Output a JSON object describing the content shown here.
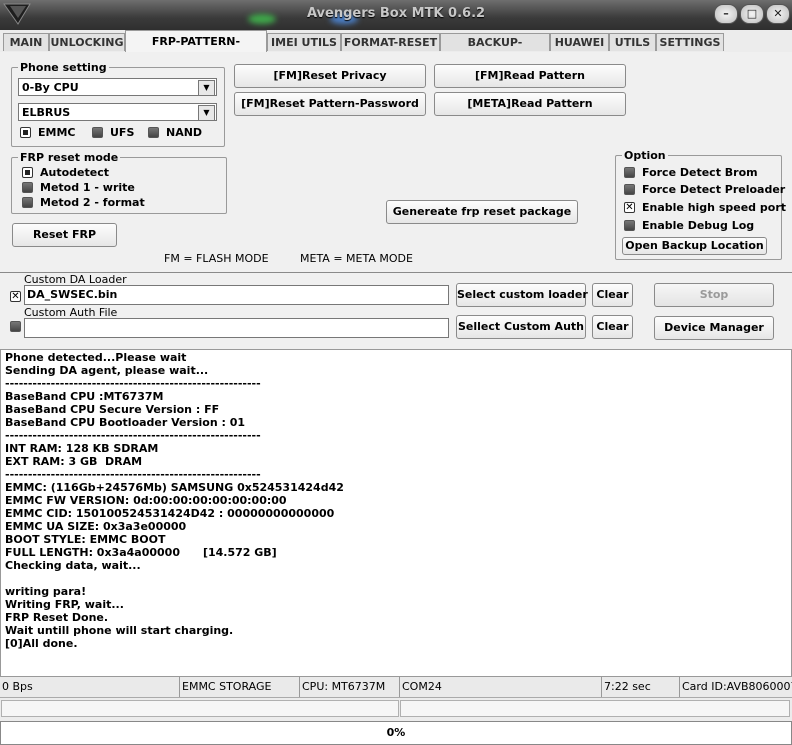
{
  "window": {
    "title": "Avengers Box MTK 0.6.2",
    "min_glyph": "–",
    "max_glyph": "□",
    "close_glyph": "✕"
  },
  "tabs": [
    {
      "label": "MAIN"
    },
    {
      "label": "UNLOCKING"
    },
    {
      "label": "FRP-PATTERN-PRIVACY",
      "active": true
    },
    {
      "label": "IMEI UTILS"
    },
    {
      "label": "FORMAT-RESET"
    },
    {
      "label": "BACKUP-RESTORE"
    },
    {
      "label": "HUAWEI"
    },
    {
      "label": "UTILS"
    },
    {
      "label": "SETTINGS"
    }
  ],
  "phone_setting": {
    "legend": "Phone setting",
    "cpu_select": "0-By CPU",
    "model_select": "ELBRUS",
    "storage": [
      {
        "label": "EMMC",
        "checked": true
      },
      {
        "label": "UFS",
        "checked": false
      },
      {
        "label": "NAND",
        "checked": false
      }
    ]
  },
  "actions": {
    "reset_privacy": "[FM]Reset Privacy",
    "read_pattern": "[FM]Read Pattern",
    "reset_pattern_password": "[FM]Reset Pattern-Password",
    "meta_read_pattern": "[META]Read Pattern"
  },
  "frp_mode": {
    "legend": "FRP reset mode",
    "options": [
      {
        "label": "Autodetect",
        "checked": true
      },
      {
        "label": "Metod 1 - write",
        "checked": false
      },
      {
        "label": "Metod 2 - format",
        "checked": false
      }
    ]
  },
  "reset_frp_button": "Reset FRP",
  "generate_button": "Genereate frp reset package",
  "legend_notes": {
    "fm": "FM = FLASH MODE",
    "meta": "META = META MODE"
  },
  "option": {
    "legend": "Option",
    "items": [
      {
        "label": "Force Detect Brom",
        "checked": false
      },
      {
        "label": "Force Detect Preloader",
        "checked": false
      },
      {
        "label": "Enable high speed port",
        "checked": true
      },
      {
        "label": "Enable Debug Log",
        "checked": false
      }
    ],
    "open_backup": "Open Backup Location"
  },
  "da": {
    "loader_label": "Custom DA Loader",
    "loader_value": "DA_SWSEC.bin",
    "loader_checked": true,
    "select_loader": "Select custom loader",
    "clear1": "Clear",
    "auth_label": "Custom Auth File",
    "auth_value": "",
    "auth_checked": false,
    "select_auth": "Sellect Custom Auth",
    "clear2": "Clear",
    "stop": "Stop",
    "device_manager": "Device Manager"
  },
  "log": [
    "Phone detected...Please wait",
    "Sending DA agent, please wait...",
    "--------------------------------------------------------",
    "BaseBand CPU :MT6737M",
    "BaseBand CPU Secure Version : FF",
    "BaseBand CPU Bootloader Version : 01",
    "--------------------------------------------------------",
    "INT RAM: 128 KB SDRAM",
    "EXT RAM: 3 GB  DRAM",
    "--------------------------------------------------------",
    "EMMC: (116Gb+24576Mb) SAMSUNG 0x524531424d42",
    "EMMC FW VERSION: 0d:00:00:00:00:00:00:00",
    "EMMC CID: 150100524531424D42 : 00000000000000",
    "EMMC UA SIZE: 0x3a3e00000",
    "BOOT STYLE: EMMC BOOT",
    "FULL LENGTH: 0x3a4a00000      [14.572 GB]",
    "Checking data, wait...",
    "",
    "writing para!",
    "Writing FRP, wait...",
    "FRP Reset Done.",
    "Wait untill phone will start charging.",
    "[0]All done."
  ],
  "status": {
    "speed": "0 Bps",
    "storage": "EMMC STORAGE",
    "cpu": "CPU: MT6737M",
    "port": "COM24",
    "time": "7:22 sec",
    "card": "Card ID:AVB8060007"
  },
  "progress": {
    "value": 0,
    "label": "0%",
    "color": "#3a7bd5"
  }
}
